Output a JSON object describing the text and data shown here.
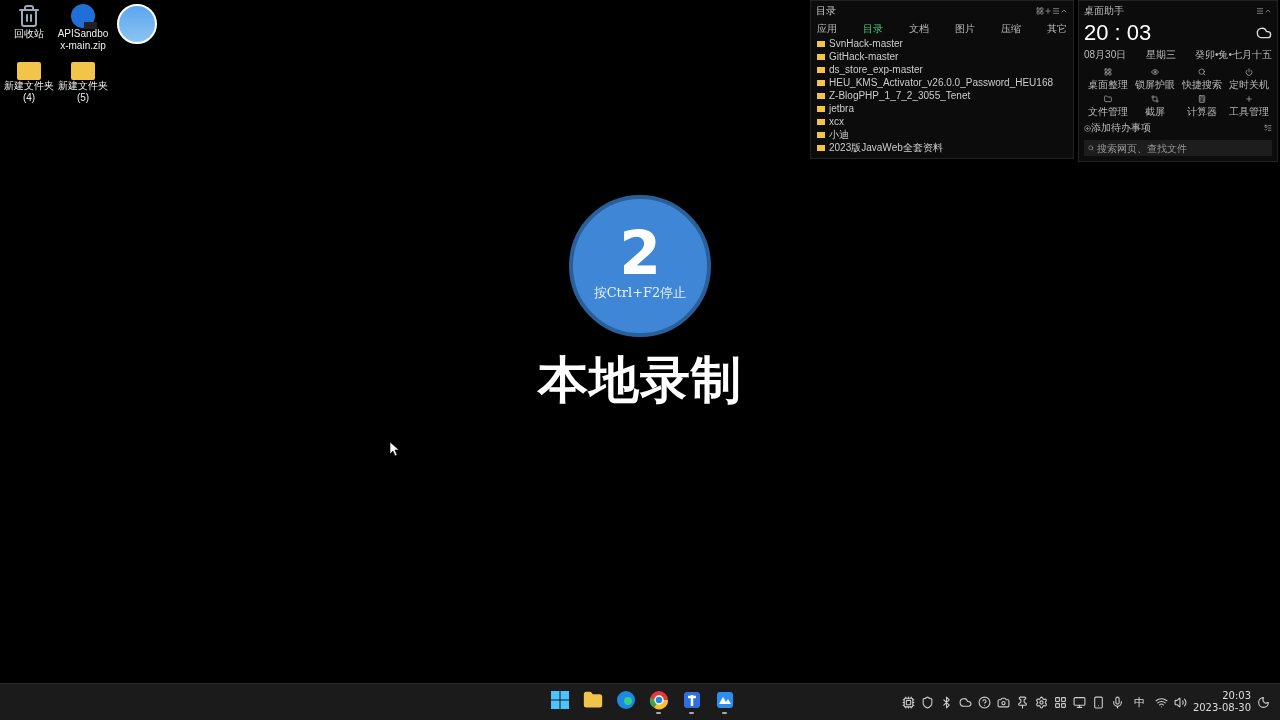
{
  "desktop_icons": [
    {
      "kind": "recycle-bin",
      "label": "回收站"
    },
    {
      "kind": "zip",
      "label": "APISandbox-main.zip"
    },
    {
      "kind": "app"
    },
    {
      "kind": "folder",
      "label": "新建文件夹 (4)"
    },
    {
      "kind": "folder",
      "label": "新建文件夹 (5)"
    }
  ],
  "file_panel": {
    "title": "目录",
    "tabs": [
      {
        "label": "应用",
        "selected": false
      },
      {
        "label": "目录",
        "selected": true
      },
      {
        "label": "文档",
        "selected": false
      },
      {
        "label": "图片",
        "selected": false
      },
      {
        "label": "压缩",
        "selected": false
      },
      {
        "label": "其它",
        "selected": false
      }
    ],
    "items": [
      "SvnHack-master",
      "GitHack-master",
      "ds_store_exp-master",
      "HEU_KMS_Activator_v26.0.0_Password_HEU168",
      "Z-BlogPHP_1_7_2_3055_Tenet",
      "jetbra",
      "xcx",
      "小迪",
      "2023版JavaWeb全套资料"
    ]
  },
  "assistant": {
    "title": "桌面助手",
    "time": "20 : 03",
    "date": "08月30日",
    "weekday": "星期三",
    "lunar": "癸卯•兔•七月十五",
    "tools": [
      {
        "kind": "organize",
        "label": "桌面整理"
      },
      {
        "kind": "eye",
        "label": "锁屏护眼"
      },
      {
        "kind": "search",
        "label": "快捷搜索"
      },
      {
        "kind": "power",
        "label": "定时关机"
      },
      {
        "kind": "folder",
        "label": "文件管理"
      },
      {
        "kind": "crop",
        "label": "截屏"
      },
      {
        "kind": "calculator",
        "label": "计算器"
      },
      {
        "kind": "plus",
        "label": "工具管理"
      }
    ],
    "todo": "添加待办事项",
    "search": {
      "placeholder": "搜索网页、查找文件"
    }
  },
  "countdown": {
    "number": "2",
    "hint": "按Ctrl+F2停止",
    "title": "本地录制"
  },
  "taskbar": {
    "apps": [
      {
        "kind": "start",
        "running": false
      },
      {
        "kind": "explorer",
        "running": false
      },
      {
        "kind": "edge",
        "running": false
      },
      {
        "kind": "chrome",
        "running": true
      },
      {
        "kind": "pin",
        "running": true
      },
      {
        "kind": "cloud",
        "running": true
      }
    ],
    "tray": [
      {
        "kind": "nvidia"
      },
      {
        "kind": "shield"
      },
      {
        "kind": "bluetooth"
      },
      {
        "kind": "cloud"
      },
      {
        "kind": "chrome"
      },
      {
        "kind": "camera"
      },
      {
        "kind": "pin"
      },
      {
        "kind": "gear"
      },
      {
        "kind": "dark"
      },
      {
        "kind": "monitor"
      },
      {
        "kind": "phone"
      },
      {
        "kind": "mic"
      }
    ],
    "ime": "中",
    "clock": {
      "time": "20:03",
      "date": "2023-08-30"
    }
  }
}
